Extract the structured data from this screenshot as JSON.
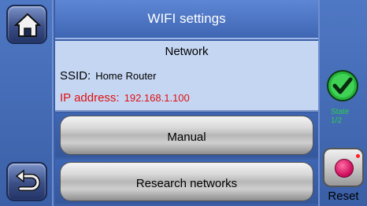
{
  "header": {
    "title": "WIFI settings"
  },
  "network": {
    "title": "Network",
    "ssid_label": "SSID:",
    "ssid_value": "Home Router",
    "ip_label": "IP address:",
    "ip_value": "192.168.1.100"
  },
  "buttons": {
    "manual": "Manual",
    "research": "Research networks",
    "reset": "Reset"
  },
  "state": {
    "line1": "State",
    "line2": "1/2"
  },
  "icons": {
    "home": "home-icon",
    "back": "back-arrow-icon",
    "state": "check-icon",
    "reset": "reset-icon"
  },
  "colors": {
    "background": "#3a5fa6",
    "ip_text": "#e01010",
    "state_text": "#2bd14a",
    "reset_dot": "#d11461"
  }
}
